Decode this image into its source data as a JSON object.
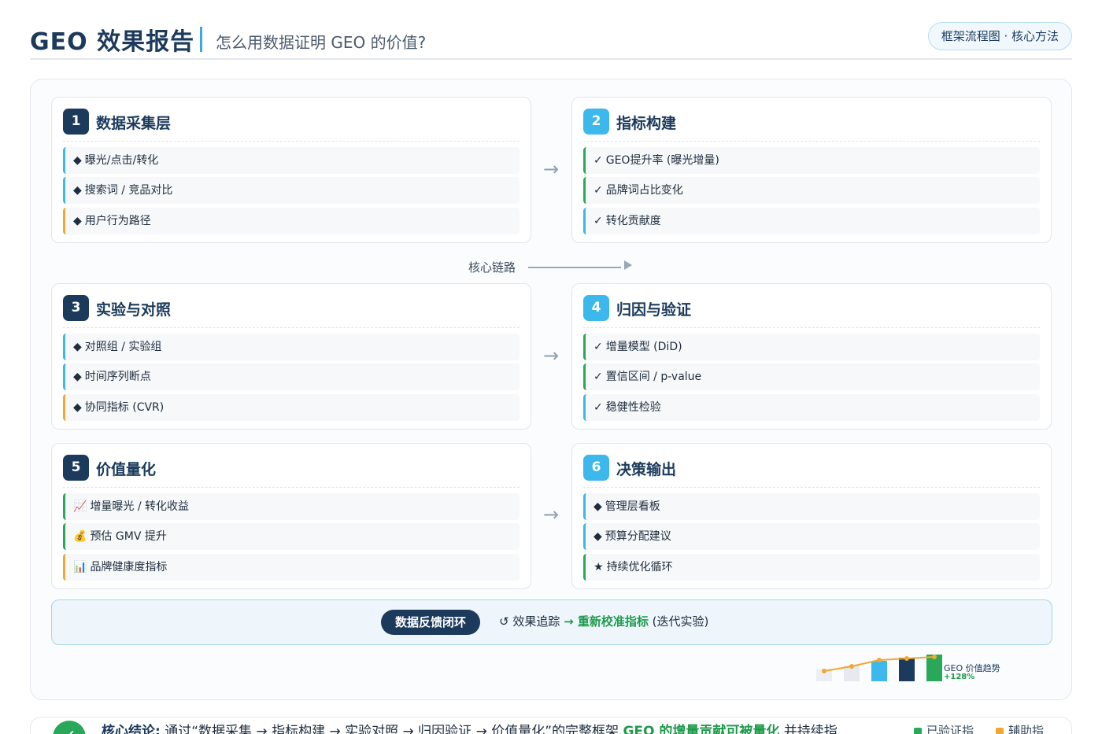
{
  "header": {
    "title": "GEO 效果报告",
    "subtitle": "怎么用数据证明 GEO 的价值?",
    "pill": "框架流程图 · 核心方法"
  },
  "chain_label": "核心链路",
  "arrow_glyph": "→",
  "cards": [
    {
      "num": "1",
      "title": "数据采集层",
      "items": [
        {
          "glyph": "◆",
          "text": "曝光/点击/转化"
        },
        {
          "glyph": "◆",
          "text": "搜索词 / 竞品对比"
        },
        {
          "glyph": "◆",
          "text": "用户行为路径"
        }
      ]
    },
    {
      "num": "2",
      "title": "指标构建",
      "items": [
        {
          "glyph": "✓",
          "text": "GEO提升率 (曝光增量)"
        },
        {
          "glyph": "✓",
          "text": "品牌词占比变化"
        },
        {
          "glyph": "✓",
          "text": "转化贡献度"
        }
      ]
    },
    {
      "num": "3",
      "title": "实验与对照",
      "items": [
        {
          "glyph": "◆",
          "text": "对照组 / 实验组"
        },
        {
          "glyph": "◆",
          "text": "时间序列断点"
        },
        {
          "glyph": "◆",
          "text": "协同指标 (CVR)"
        }
      ]
    },
    {
      "num": "4",
      "title": "归因与验证",
      "items": [
        {
          "glyph": "✓",
          "text": "增量模型 (DiD)"
        },
        {
          "glyph": "✓",
          "text": "置信区间 / p-value"
        },
        {
          "glyph": "✓",
          "text": "稳健性检验"
        }
      ]
    },
    {
      "num": "5",
      "title": "价值量化",
      "items": [
        {
          "glyph": "📈",
          "text": "增量曝光 / 转化收益"
        },
        {
          "glyph": "💰",
          "text": "预估 GMV 提升"
        },
        {
          "glyph": "📊",
          "text": "品牌健康度指标"
        }
      ]
    },
    {
      "num": "6",
      "title": "决策输出",
      "items": [
        {
          "glyph": "◆",
          "text": "管理层看板"
        },
        {
          "glyph": "◆",
          "text": "预算分配建议"
        },
        {
          "glyph": "★",
          "text": "持续优化循环"
        }
      ]
    }
  ],
  "loop": {
    "badge": "数据反馈闭环",
    "prefix": "↺ 效果追踪 ",
    "highlight": "→ 重新校准指标",
    "suffix": " (迭代实验)"
  },
  "trend": {
    "label": "GEO 价值趋势",
    "pct": "+128%",
    "colors": [
      "#eceff2",
      "#e6eaee",
      "#3cb8ec",
      "#1b3a5c",
      "#2aa85a"
    ],
    "line_color": "#f0a830"
  },
  "footer": {
    "icon": "✓",
    "label": "核心结论:",
    "text": "通过“数据采集 → 指标构建 → 实验对照 → 归因验证 → 价值量化”的完整框架,",
    "highlight": "GEO 的增量贡献可被量化",
    "tail": ",并持续指",
    "legend": [
      {
        "label": "已验证指",
        "color": "#2aa85a"
      },
      {
        "label": "辅助指",
        "color": "#f0a830"
      }
    ]
  },
  "colors": {
    "navy": "#1b3a5c",
    "sky": "#3cb8ec",
    "green": "#2aa85a",
    "orange": "#f0a830"
  }
}
